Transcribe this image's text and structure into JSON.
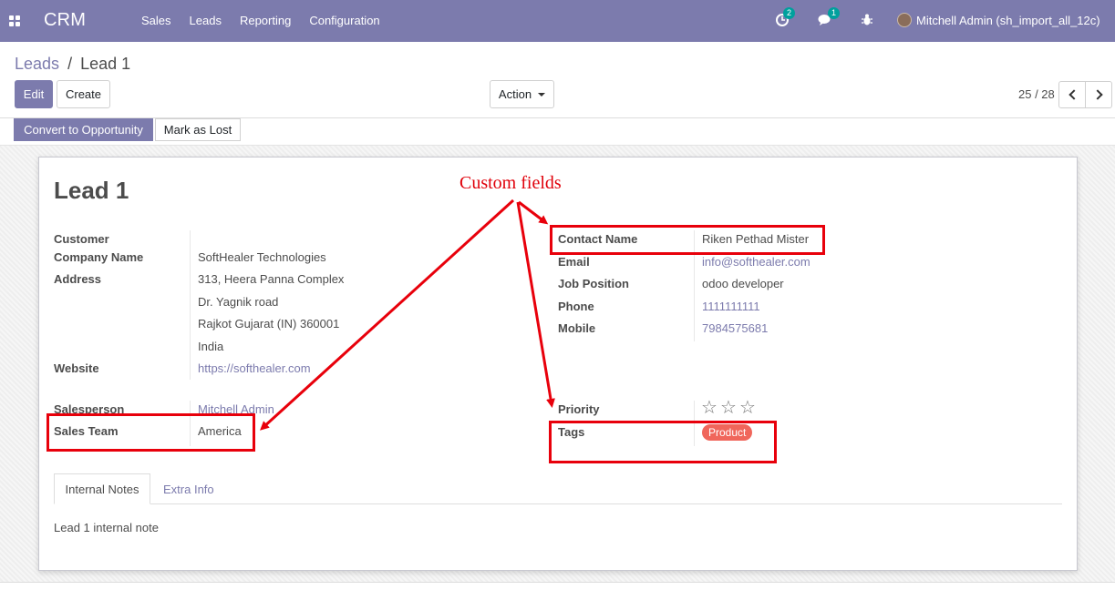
{
  "navbar": {
    "brand": "CRM",
    "menu": [
      "Sales",
      "Leads",
      "Reporting",
      "Configuration"
    ],
    "activity_count": "2",
    "message_count": "1",
    "user_name": "Mitchell Admin (sh_import_all_12c)"
  },
  "breadcrumb": {
    "parent": "Leads",
    "separator": "/",
    "current": "Lead 1"
  },
  "buttons": {
    "edit": "Edit",
    "create": "Create",
    "action": "Action",
    "convert": "Convert to Opportunity",
    "mark_lost": "Mark as Lost"
  },
  "pager": {
    "text": "25 / 28"
  },
  "form": {
    "title": "Lead 1",
    "left": [
      {
        "label": "Customer",
        "value": ""
      },
      {
        "label": "Company Name",
        "value": "SoftHealer Technologies"
      },
      {
        "label": "Address",
        "value": ""
      },
      {
        "label": "Website",
        "value": "https://softhealer.com"
      },
      {
        "label": "Salesperson",
        "value": "Mitchell Admin"
      },
      {
        "label": "Sales Team",
        "value": "America"
      }
    ],
    "address_lines": [
      "313, Heera Panna Complex",
      "Dr. Yagnik road",
      "Rajkot  Gujarat (IN)  360001",
      "India"
    ],
    "right": [
      {
        "label": "Contact Name",
        "value": "Riken Pethad  Mister"
      },
      {
        "label": "Email",
        "value": "info@softhealer.com"
      },
      {
        "label": "Job Position",
        "value": "odoo developer"
      },
      {
        "label": "Phone",
        "value": "1111111111"
      },
      {
        "label": "Mobile",
        "value": "7984575681"
      },
      {
        "label": "Priority",
        "value": ""
      },
      {
        "label": "Tags",
        "value": ""
      }
    ],
    "priority_stars": 0,
    "tag": "Product"
  },
  "tabs": {
    "internal_notes": "Internal Notes",
    "extra_info": "Extra Info"
  },
  "note": "Lead 1 internal note",
  "annotation": {
    "label": "Custom fields",
    "color": "#e8000b"
  },
  "colors": {
    "brand": "#7c7bad",
    "tag": "#f0665b",
    "badge": "#00a09d"
  }
}
